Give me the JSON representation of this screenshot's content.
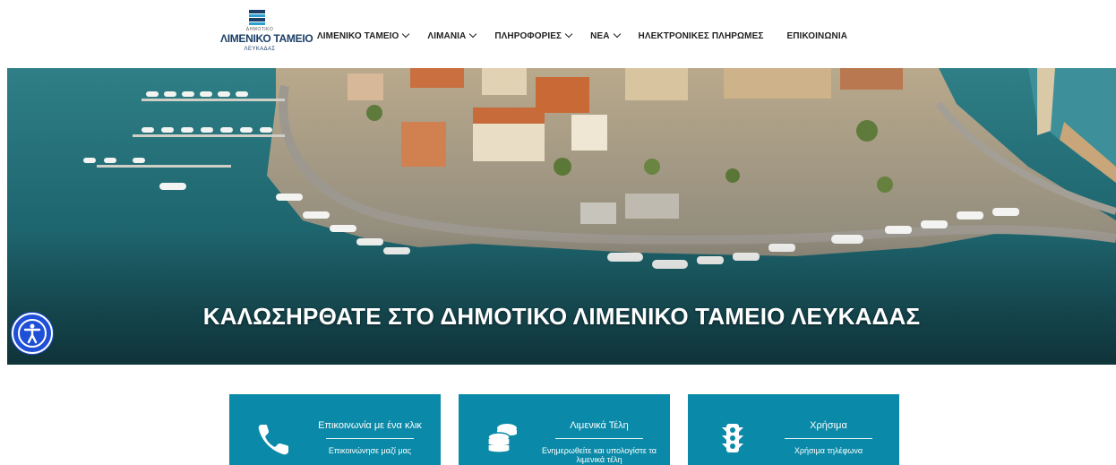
{
  "logo": {
    "small": "ΔΗΜΟΤΙΚΟ",
    "main": "ΛΙΜΕΝΙΚΟ ΤΑΜΕΙΟ",
    "sub": "ΛΕΥΚΑΔΑΣ"
  },
  "nav": {
    "items": [
      {
        "label": "ΛΙΜΕΝΙΚΟ ΤΑΜΕΙΟ",
        "dropdown": true
      },
      {
        "label": "ΛΙΜΑΝΙΑ",
        "dropdown": true
      },
      {
        "label": "ΠΛΗΡΟΦΟΡΙΕΣ",
        "dropdown": true
      },
      {
        "label": "ΝΕΑ",
        "dropdown": true
      },
      {
        "label": "ΗΛΕΚΤΡΟΝΙΚΕΣ ΠΛΗΡΩΜΕΣ",
        "dropdown": false
      },
      {
        "label": "ΕΠΙΚΟΙΝΩΝΙΑ",
        "dropdown": false
      }
    ]
  },
  "hero": {
    "title": "ΚΑΛΩΣΗΡΘΑΤΕ ΣΤΟ ΔΗΜΟΤΙΚΟ ΛΙΜΕΝΙΚΟ ΤΑΜΕΙΟ ΛΕΥΚΑΔΑΣ",
    "image": "aerial-harbor-marina-photo"
  },
  "accessibility": {
    "icon": "accessibility-icon",
    "color": "#1e4fd6"
  },
  "cards": [
    {
      "icon": "phone-icon",
      "title": "Επικοινωνία με ένα κλικ",
      "text": "Επικοινώνησε μαζί μας"
    },
    {
      "icon": "coins-icon",
      "title": "Λιμενικά Τέλη",
      "text": "Ενημερωθείτε και υπολογίστε τα λιμενικά τέλη"
    },
    {
      "icon": "traffic-light-icon",
      "title": "Χρήσιμα",
      "text": "Χρήσιμα τηλέφωνα"
    }
  ],
  "colors": {
    "card": "#0a8aa8",
    "nav_text": "#1f1f1f",
    "logo": "#1b3f66"
  }
}
